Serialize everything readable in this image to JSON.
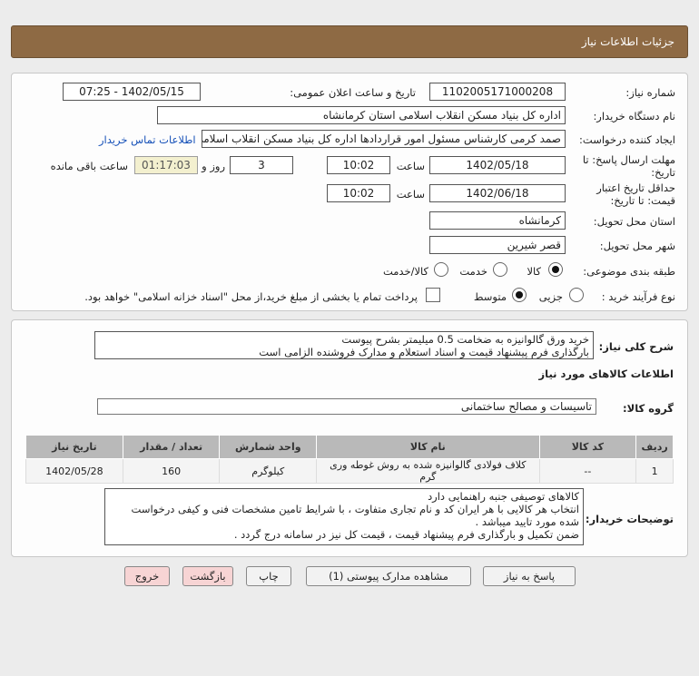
{
  "header": {
    "title": "جزئیات اطلاعات نیاز"
  },
  "form": {
    "need_number_label": "شماره نیاز:",
    "need_number": "1102005171000208",
    "announce_label": "تاریخ و ساعت اعلان عمومی:",
    "announce_value": "1402/05/15 - 07:25",
    "buyer_org_label": "نام دستگاه خریدار:",
    "buyer_org": "اداره کل بنیاد مسکن انقلاب اسلامی استان کرمانشاه",
    "creator_label": "ایجاد کننده درخواست:",
    "creator": "صمد کرمی کارشناس مسئول امور قراردادها اداره کل بنیاد مسکن انقلاب اسلامی",
    "contact_link": "اطلاعات تماس خریدار",
    "reply_deadline_label": "مهلت ارسال پاسخ: تا تاریخ:",
    "reply_date": "1402/05/18",
    "time_label": "ساعت",
    "reply_time": "10:02",
    "days_value": "3",
    "days_label": "روز و",
    "remaining_time": "01:17:03",
    "remaining_label": "ساعت باقی مانده",
    "validity_label": "حداقل تاریخ اعتبار قیمت: تا تاریخ:",
    "validity_date": "1402/06/18",
    "validity_time_label": "ساعت",
    "validity_time": "10:02",
    "province_label": "استان محل تحویل:",
    "province": "کرمانشاه",
    "city_label": "شهر محل تحویل:",
    "city": "قصر شیرین",
    "category_label": "طبقه بندی موضوعی:",
    "category_options": [
      "کالا",
      "خدمت",
      "کالا/خدمت"
    ],
    "process_label": "نوع فرآیند خرید :",
    "process_options": [
      "جزیی",
      "متوسط"
    ],
    "payment_note": "پرداخت تمام یا بخشی از مبلغ خرید،از محل \"اسناد خزانه اسلامی\" خواهد بود."
  },
  "summary": {
    "label": "شرح کلی نیاز:",
    "line1": "خرید ورق گالوانیزه به ضخامت 0.5 میلیمتر بشرح پیوست",
    "line2": "بارگذاری فرم پیشنهاد قیمت و اسناد استعلام و مدارک فروشنده الزامی است",
    "items_heading": "اطلاعات کالاهای مورد نیاز",
    "group_label": "گروه کالا:",
    "group_value": "تاسیسات و مصالح ساختمانی"
  },
  "table": {
    "headers": [
      "ردیف",
      "کد کالا",
      "نام کالا",
      "واحد شمارش",
      "تعداد / مقدار",
      "تاریخ نیاز"
    ],
    "rows": [
      [
        "1",
        "--",
        "کلاف فولادی گالوانیزه شده به روش غوطه وری گرم",
        "کیلوگرم",
        "160",
        "1402/05/28"
      ]
    ]
  },
  "buyer_notes": {
    "label": "توضیحات خریدار:",
    "lines": [
      "کالاهای توصیفی جنبه راهنمایی دارد",
      "انتخاب هر کالایی با هر ایران کد و نام تجاری متفاوت ، با شرایط تامین مشخصات فنی و کیفی درخواست",
      "شده مورد تایید میباشد .",
      "ضمن تکمیل و بارگذاری فرم پیشنهاد قیمت ، قیمت کل نیز در سامانه درج گردد ."
    ]
  },
  "buttons": {
    "reply": "پاسخ به نیاز",
    "attachments": "مشاهده مدارک پیوستی (1)",
    "print": "چاپ",
    "back": "بازگشت",
    "exit": "خروج"
  }
}
